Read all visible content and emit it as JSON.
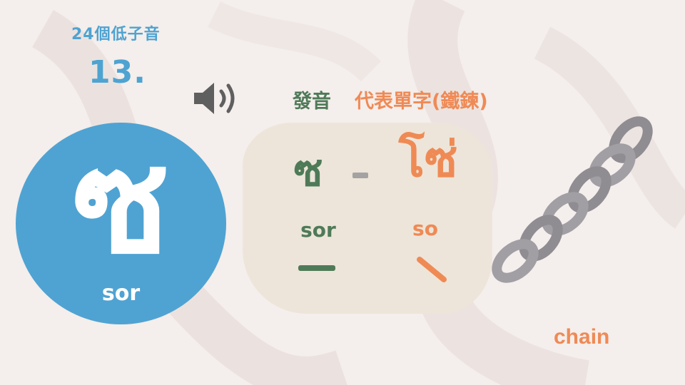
{
  "series_title": "24個低子音",
  "letter_number": "13.",
  "labels": {
    "pronunciation": "發音",
    "representative_word": "代表單字(鐵鍊)"
  },
  "letter": {
    "character": "ซ",
    "roman": "sor"
  },
  "card": {
    "consonant": "ซ",
    "word": "โซ่",
    "consonant_roman": "sor",
    "word_roman": "so",
    "consonant_tone_icon": "flat-tone-mark",
    "word_tone_icon": "falling-tone-mark"
  },
  "image": {
    "icon": "chain-icon",
    "label": "chain"
  },
  "colors": {
    "blue": "#4fa3d2",
    "green": "#4f7a58",
    "orange": "#ef8a55",
    "card_bg": "#ede5d9",
    "chain_gray": "#8f8c92"
  }
}
